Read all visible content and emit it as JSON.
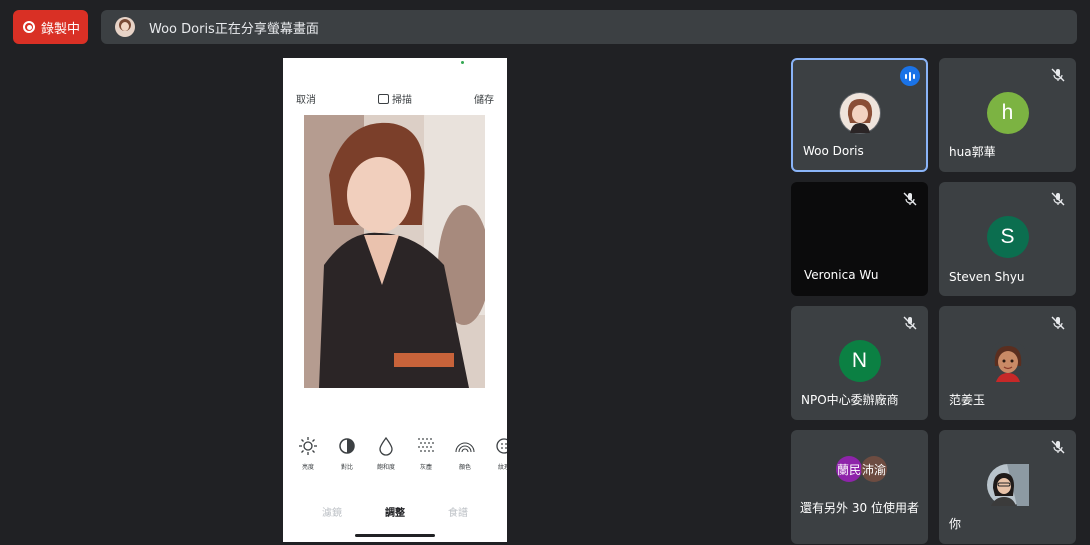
{
  "recording": {
    "label": "錄製中"
  },
  "share_bar": {
    "text": "Woo Doris正在分享螢幕畫面"
  },
  "phone": {
    "top": {
      "cancel": "取消",
      "scan": "掃描",
      "save": "儲存"
    },
    "tools": [
      {
        "label": "亮度",
        "icon": "brightness-icon"
      },
      {
        "label": "對比",
        "icon": "contrast-icon"
      },
      {
        "label": "飽和度",
        "icon": "saturation-icon"
      },
      {
        "label": "灰塵",
        "icon": "dust-icon"
      },
      {
        "label": "顏色",
        "icon": "color-icon"
      },
      {
        "label": "紋理",
        "icon": "texture-icon"
      }
    ],
    "tabs": {
      "filter": "濾鏡",
      "adjust": "調整",
      "recipe": "食譜"
    }
  },
  "participants": [
    {
      "name": "Woo Doris",
      "avatar": "photo",
      "speaking": true
    },
    {
      "name": "hua郭華",
      "initial": "h",
      "color": "#7cb342",
      "muted": true
    },
    {
      "name": "Veronica Wu",
      "video": true,
      "muted": true
    },
    {
      "name": "Steven Shyu",
      "initial": "S",
      "color": "#0b6e4f",
      "muted": true
    },
    {
      "name": "NPO中心委辦廠商",
      "initial": "N",
      "color": "#0b8043",
      "muted": true
    },
    {
      "name": "范姜玉",
      "avatar": "cartoon",
      "muted": true
    },
    {
      "name": "你",
      "avatar": "photo",
      "muted": true
    }
  ],
  "more": {
    "text": "還有另外 30 位使用者",
    "avatars": [
      {
        "text": "蘭民",
        "color": "#8e24aa"
      },
      {
        "text": "沛渝",
        "color": "#6d4c41"
      }
    ]
  },
  "colors": {
    "accent": "#8ab4f8",
    "record": "#d93025",
    "tile": "#3c4043"
  }
}
